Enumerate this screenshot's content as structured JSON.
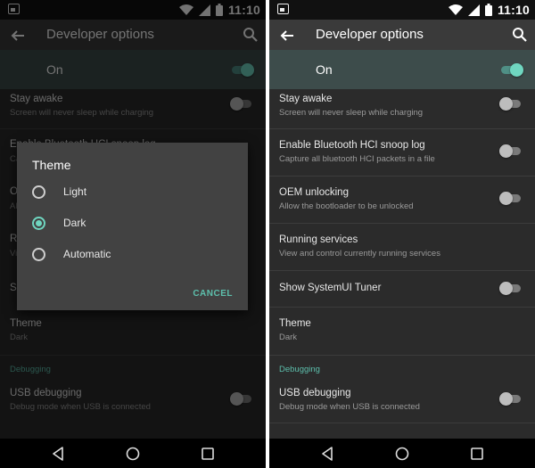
{
  "status_bar": {
    "time": "11:10"
  },
  "app_bar": {
    "title": "Developer options"
  },
  "master_switch": {
    "label": "On",
    "state": "on"
  },
  "settings": [
    {
      "title": "Stay awake",
      "summary": "Screen will never sleep while charging",
      "switch": "off"
    },
    {
      "title": "Enable Bluetooth HCI snoop log",
      "summary": "Capture all bluetooth HCI packets in a file",
      "switch": "off"
    },
    {
      "title": "OEM unlocking",
      "summary": "Allow the bootloader to be unlocked",
      "switch": "off"
    },
    {
      "title": "Running services",
      "summary": "View and control currently running services"
    },
    {
      "title": "Show SystemUI Tuner",
      "switch": "off"
    },
    {
      "title": "Theme",
      "summary": "Dark"
    }
  ],
  "debugging": {
    "heading": "Debugging",
    "usb": {
      "title": "USB debugging",
      "summary": "Debug mode when USB is connected",
      "switch": "off"
    }
  },
  "theme_dialog": {
    "title": "Theme",
    "options": [
      {
        "label": "Light",
        "selected": false
      },
      {
        "label": "Dark",
        "selected": true
      },
      {
        "label": "Automatic",
        "selected": false
      }
    ],
    "cancel_label": "CANCEL"
  },
  "colors": {
    "accent": "#6fd6c0",
    "background": "#2b2b2b",
    "master_row": "#3d4c4b"
  },
  "icons": [
    "image-notification-icon",
    "wifi-icon",
    "signal-icon",
    "battery-icon",
    "back-arrow-icon",
    "search-icon",
    "nav-back-icon",
    "nav-home-icon",
    "nav-recents-icon"
  ]
}
